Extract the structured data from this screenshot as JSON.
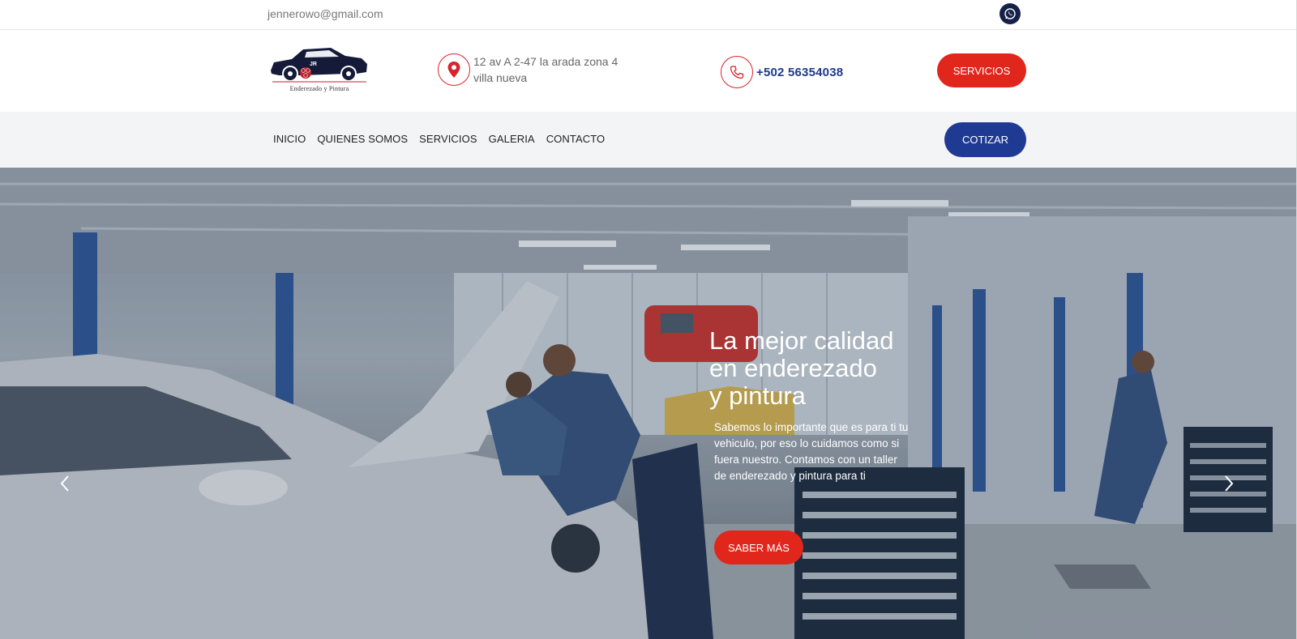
{
  "topbar": {
    "email": "jennerowo@gmail.com",
    "whatsapp_icon": "whatsapp-icon"
  },
  "header": {
    "logo_text": "Enderezado y Pintura",
    "logo_badge": "JR",
    "address_line1": "12 av A 2-47 la arada zona 4",
    "address_line2": "villa nueva",
    "phone": "+502 56354038",
    "servicios_button": "SERVICIOS"
  },
  "nav": {
    "items": [
      {
        "label": "INICIO"
      },
      {
        "label": "QUIENES SOMOS"
      },
      {
        "label": "SERVICIOS"
      },
      {
        "label": "GALERIA"
      },
      {
        "label": "CONTACTO"
      }
    ],
    "cotizar_button": "COTIZAR"
  },
  "hero": {
    "title_line1": "La mejor calidad",
    "title_line2": "en enderezado",
    "title_line3": "y pintura",
    "description": "Sabemos lo importante que es para ti tu vehiculo, por eso lo cuidamos como si fuera nuestro. Contamos con un taller de enderezado y pintura para ti",
    "button": "SABER MÁS"
  },
  "colors": {
    "accent_red": "#e1261c",
    "accent_blue": "#1f3a93",
    "nav_bg": "#f2f4f6"
  }
}
